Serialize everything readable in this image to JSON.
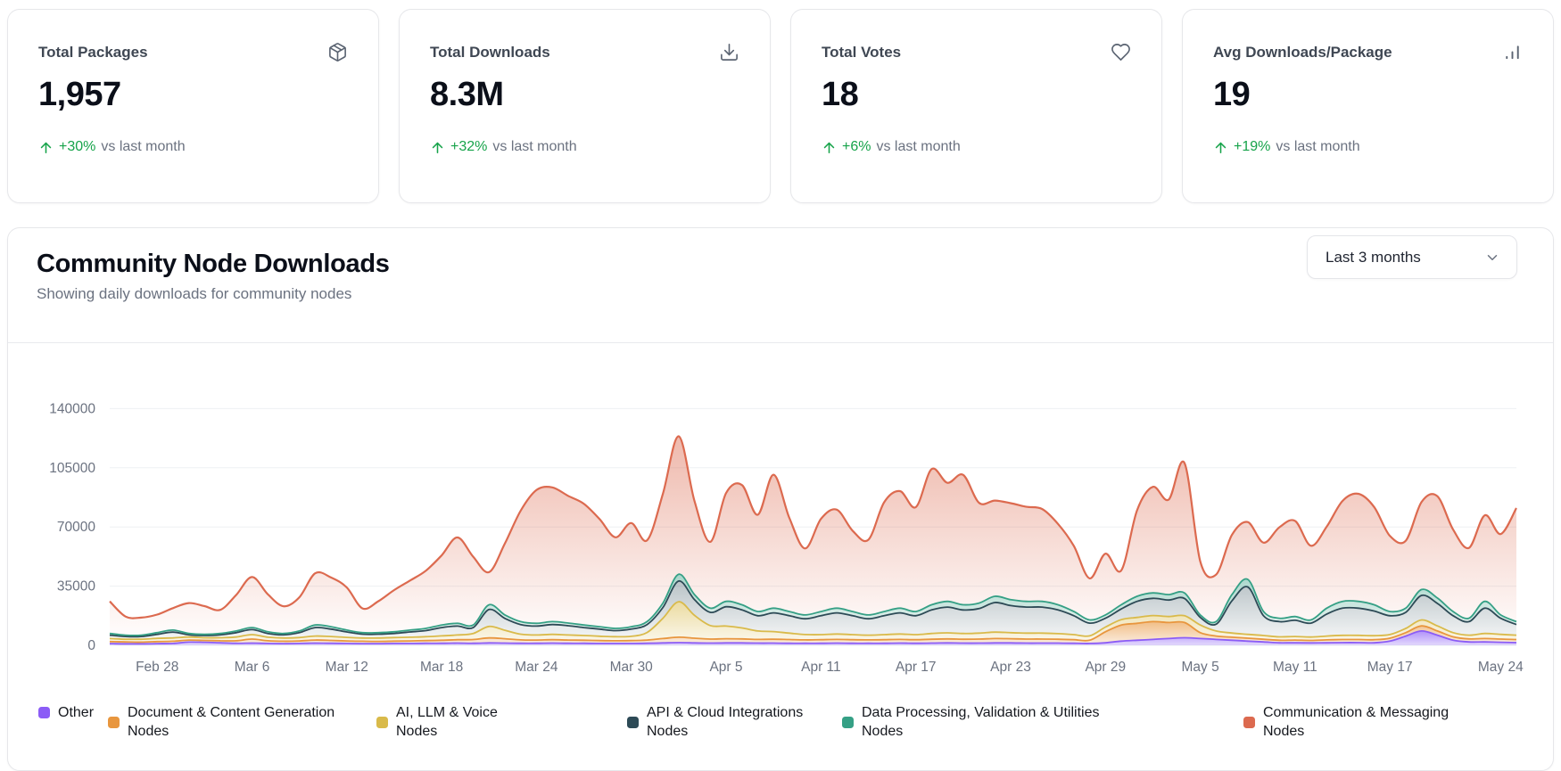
{
  "stat_cards": [
    {
      "title": "Total Packages",
      "value": "1,957",
      "delta": "+30%",
      "delta_suffix": "vs last month",
      "icon": "package-icon"
    },
    {
      "title": "Total Downloads",
      "value": "8.3M",
      "delta": "+32%",
      "delta_suffix": "vs last month",
      "icon": "download-icon"
    },
    {
      "title": "Total Votes",
      "value": "18",
      "delta": "+6%",
      "delta_suffix": "vs last month",
      "icon": "heart-icon"
    },
    {
      "title": "Avg Downloads/Package",
      "value": "19",
      "delta": "+19%",
      "delta_suffix": "vs last month",
      "icon": "bar-chart-icon"
    }
  ],
  "chart_card": {
    "title": "Community Node Downloads",
    "subtitle": "Showing daily downloads for community nodes",
    "range_selector": {
      "value": "Last 3 months",
      "icon": "chevron-down-icon"
    }
  },
  "colors": {
    "positive_green": "#16a34a",
    "muted_text": "#6b7280",
    "grid_line": "#eef0f3"
  },
  "chart_data": {
    "type": "area",
    "stacked": true,
    "x_start": "Feb 25",
    "x_end": "May 25",
    "x_tick_labels": [
      "Feb 28",
      "Mar 6",
      "Mar 12",
      "Mar 18",
      "Mar 24",
      "Mar 30",
      "Apr 5",
      "Apr 11",
      "Apr 17",
      "Apr 23",
      "Apr 29",
      "May 5",
      "May 11",
      "May 17",
      "May 24"
    ],
    "x_tick_indices": [
      3,
      9,
      15,
      21,
      27,
      33,
      39,
      45,
      51,
      57,
      63,
      69,
      75,
      81,
      88
    ],
    "y_ticks": [
      0,
      35000,
      70000,
      105000,
      140000
    ],
    "y_tick_labels": [
      "0",
      "35000",
      "70000",
      "105000",
      "140000"
    ],
    "ylim": [
      0,
      148000
    ],
    "grid": true,
    "legend_position": "bottom",
    "series": [
      {
        "name": "Other",
        "color": "#8b5cf6",
        "values": [
          1000,
          900,
          900,
          1000,
          1100,
          1900,
          1800,
          1500,
          1200,
          1300,
          1100,
          1000,
          1100,
          1300,
          1200,
          1100,
          1000,
          1000,
          1100,
          1100,
          1200,
          1200,
          1300,
          1200,
          1400,
          1300,
          1200,
          1200,
          1300,
          1200,
          1200,
          1100,
          1100,
          1100,
          1200,
          1400,
          1600,
          1400,
          1300,
          1400,
          1400,
          1300,
          1300,
          1200,
          1200,
          1200,
          1300,
          1200,
          1200,
          1200,
          1300,
          1200,
          1300,
          1400,
          1300,
          1300,
          1400,
          1400,
          1300,
          1300,
          1300,
          1200,
          1100,
          1500,
          2500,
          3000,
          3500,
          4000,
          4500,
          4000,
          3500,
          3000,
          2500,
          2000,
          1500,
          1500,
          1400,
          1500,
          1600,
          1600,
          1500,
          2500,
          5500,
          8500,
          6000,
          3000,
          2000,
          2000,
          1800,
          1600
        ]
      },
      {
        "name": "Document & Content Generation Nodes",
        "color": "#e8963e",
        "values": [
          1200,
          1100,
          1000,
          1200,
          1300,
          1200,
          1100,
          1200,
          1500,
          2400,
          1600,
          1400,
          1500,
          1800,
          1700,
          1500,
          1400,
          1300,
          1400,
          1500,
          1600,
          1800,
          2000,
          2200,
          3000,
          2600,
          2000,
          1900,
          2000,
          1900,
          1800,
          1700,
          1600,
          1700,
          1900,
          2600,
          3200,
          2800,
          2400,
          2500,
          2400,
          2200,
          2300,
          2200,
          2000,
          2100,
          2200,
          2100,
          2000,
          2100,
          2200,
          2100,
          2300,
          2400,
          2300,
          2400,
          2600,
          2500,
          2400,
          2400,
          2300,
          2100,
          1900,
          6500,
          9500,
          10000,
          10500,
          9500,
          9000,
          3500,
          2000,
          1800,
          1700,
          1600,
          1500,
          1600,
          1500,
          1700,
          1800,
          1800,
          1800,
          1700,
          2000,
          3000,
          2500,
          2000,
          1800,
          2000,
          1900,
          1800
        ]
      },
      {
        "name": "AI, LLM & Voice Nodes",
        "color": "#d9ba4a",
        "values": [
          1800,
          1600,
          1700,
          1900,
          2000,
          1800,
          1600,
          1800,
          2200,
          2600,
          2100,
          1900,
          2000,
          2400,
          2300,
          2100,
          1900,
          2000,
          2100,
          2200,
          2300,
          2600,
          2800,
          3600,
          6800,
          5000,
          3400,
          3000,
          3200,
          3000,
          2800,
          2600,
          2400,
          2500,
          4500,
          12000,
          21000,
          13500,
          8000,
          7500,
          6500,
          5000,
          4500,
          3800,
          3200,
          3000,
          3200,
          3000,
          2800,
          3000,
          3200,
          3000,
          3400,
          3600,
          3400,
          3500,
          3800,
          3600,
          3500,
          3500,
          3300,
          3000,
          2600,
          2800,
          3200,
          3500,
          3600,
          3500,
          4000,
          4500,
          3000,
          2500,
          2300,
          2200,
          2000,
          2100,
          2000,
          2300,
          2500,
          2500,
          2400,
          2200,
          2500,
          3500,
          3000,
          2500,
          2200,
          3000,
          2800,
          2600
        ]
      },
      {
        "name": "API & Cloud Integrations Nodes",
        "color": "#2d4a56",
        "values": [
          2000,
          1600,
          1600,
          2400,
          3400,
          1300,
          1300,
          1700,
          2600,
          3000,
          2200,
          1900,
          2900,
          5000,
          4400,
          3200,
          2300,
          2300,
          2400,
          3100,
          3600,
          4900,
          5300,
          3500,
          10000,
          7000,
          5700,
          5300,
          5800,
          5500,
          4700,
          4200,
          3600,
          4300,
          4700,
          6400,
          12200,
          9300,
          7800,
          11400,
          10700,
          9000,
          11100,
          10300,
          9300,
          11200,
          12500,
          11200,
          9700,
          11200,
          12500,
          11200,
          13900,
          15200,
          13900,
          14500,
          17500,
          16000,
          15400,
          15400,
          14000,
          11200,
          7500,
          5200,
          6300,
          9500,
          10200,
          9800,
          10200,
          4500,
          4000,
          19000,
          28000,
          11700,
          9000,
          9600,
          8200,
          13000,
          16100,
          16100,
          14600,
          11100,
          9500,
          14500,
          13300,
          10000,
          8000,
          15000,
          9500,
          6300
        ]
      },
      {
        "name": "Data Processing, Validation & Utilities Nodes",
        "color": "#35a085",
        "values": [
          1000,
          800,
          800,
          1000,
          1200,
          800,
          700,
          800,
          1000,
          1200,
          1000,
          800,
          1000,
          1500,
          1400,
          1100,
          900,
          900,
          1000,
          1100,
          1300,
          1500,
          1600,
          1500,
          2800,
          2100,
          1700,
          1600,
          1700,
          1600,
          1500,
          1400,
          1300,
          1400,
          1700,
          2600,
          4000,
          3000,
          2500,
          3200,
          3000,
          2500,
          2800,
          2500,
          2300,
          2500,
          2800,
          2500,
          2300,
          2500,
          2800,
          2500,
          3100,
          3400,
          3100,
          3300,
          3700,
          3500,
          3400,
          3400,
          3100,
          2500,
          1900,
          2000,
          2500,
          3000,
          3200,
          3200,
          3300,
          1500,
          1500,
          3700,
          4500,
          2500,
          2000,
          2200,
          1900,
          3500,
          4000,
          4000,
          3700,
          2500,
          2500,
          3500,
          3200,
          2500,
          2000,
          4000,
          2000,
          1700
        ]
      },
      {
        "name": "Communication & Messaging Nodes",
        "color": "#dc6a4f",
        "values": [
          19000,
          11000,
          10400,
          10700,
          13000,
          18000,
          16700,
          14000,
          21300,
          29900,
          22200,
          16100,
          19900,
          30600,
          29100,
          25200,
          14300,
          18600,
          24700,
          29300,
          34100,
          41200,
          50800,
          40400,
          19300,
          42200,
          65600,
          78800,
          79400,
          75200,
          71700,
          63600,
          53900,
          61300,
          48100,
          64700,
          81600,
          55300,
          39200,
          64100,
          70800,
          57200,
          78900,
          55400,
          39300,
          54800,
          58200,
          47800,
          44400,
          64600,
          69200,
          61700,
          80200,
          70100,
          76800,
          59300,
          56600,
          57100,
          55900,
          54600,
          47800,
          38700,
          24600,
          36200,
          20300,
          50800,
          62700,
          56200,
          76800,
          31600,
          27800,
          35300,
          33900,
          40700,
          53800,
          56600,
          43900,
          48200,
          59400,
          63600,
          57800,
          44700,
          39900,
          51800,
          60200,
          48400,
          41600,
          50900,
          47800,
          67200
        ]
      }
    ]
  }
}
